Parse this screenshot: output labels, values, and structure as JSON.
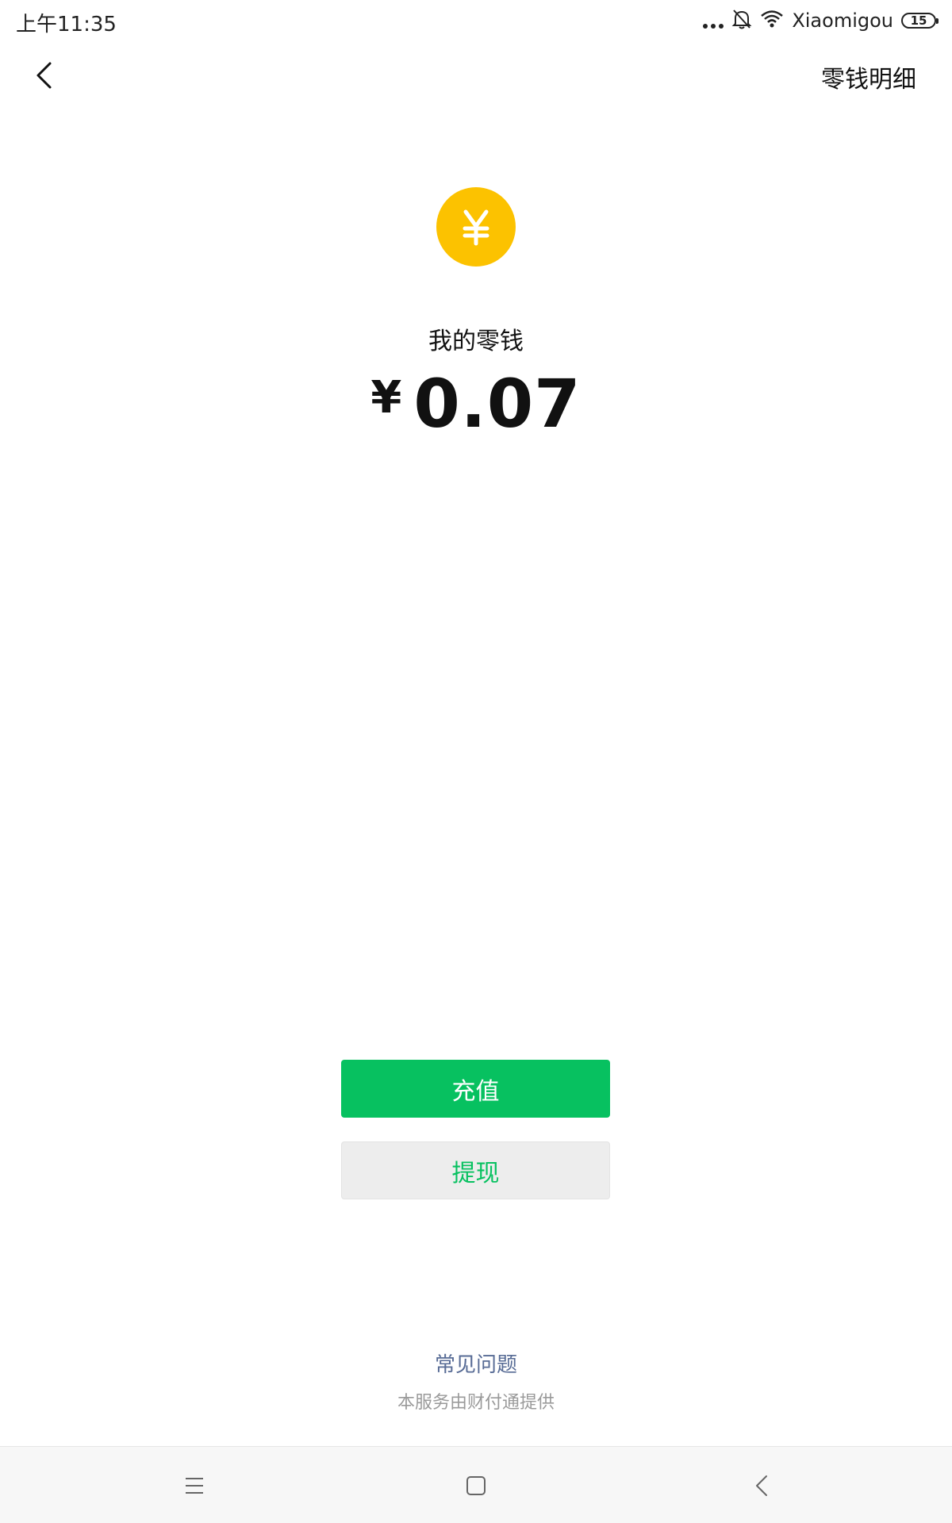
{
  "status_bar": {
    "time": "上午11:35",
    "carrier": "Xiaomigou",
    "battery": "15"
  },
  "nav": {
    "detail_link": "零钱明细"
  },
  "wallet": {
    "coin_symbol": "¥",
    "label": "我的零钱",
    "currency": "¥",
    "amount": "0.07"
  },
  "actions": {
    "recharge": "充值",
    "withdraw": "提现"
  },
  "footer": {
    "faq": "常见问题",
    "service_note": "本服务由财付通提供"
  },
  "colors": {
    "accent_green": "#07C160",
    "coin_yellow": "#FCC200",
    "link_blue": "#576B95"
  }
}
